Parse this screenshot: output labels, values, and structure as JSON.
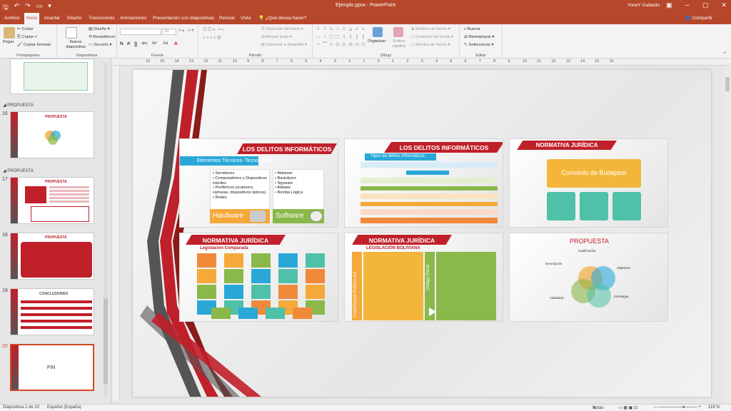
{
  "titlebar": {
    "title": "Ejemplo.ppsx  -  PowerPoint",
    "user": "YoneY Gallardo",
    "bg_color": "#b7472a"
  },
  "tabs": [
    "Archivo",
    "Inicio",
    "Insertar",
    "Diseño",
    "Transiciones",
    "Animaciones",
    "Presentación con diapositivas",
    "Revisar",
    "Vista"
  ],
  "active_tab": "Inicio",
  "tell_me": "¿Qué desea hacer?",
  "share": "Compartir",
  "ribbon": {
    "paste": "Pegar",
    "cut": "Cortar",
    "copy": "Copiar",
    "format_painter": "Copiar formato",
    "g_clipboard": "Portapapeles",
    "new_slide": "Nueva diapositiva",
    "layout": "Diseño",
    "reset": "Restablecer",
    "section": "Sección",
    "g_slides": "Diapositivas",
    "font_size": "32",
    "format_letters": [
      "N",
      "K",
      "S",
      "abc",
      "AV",
      "Aa"
    ],
    "g_font": "Fuente",
    "text_direction": "Dirección del texto",
    "align_text": "Alinear texto",
    "smartart": "Convertir a SmartArt",
    "g_paragraph": "Párrafo",
    "organize": "Organizar",
    "quick_styles": "Estilos rápidos",
    "shape_fill": "Relleno de forma",
    "shape_outline": "Contorno de forma",
    "shape_effects": "Efectos de forma",
    "g_drawing": "Dibujo",
    "find": "Buscar",
    "replace": "Reemplazar",
    "select": "Seleccionar",
    "g_editing": "Editar",
    "shape_glyphs": [
      "\\",
      "\\",
      "□",
      "○",
      "□",
      "△",
      "⌐",
      "⌐",
      "→",
      "↓",
      "⬚",
      "⬚",
      "⟨",
      "⟩",
      "{",
      "}",
      "~",
      "⌒",
      "☆",
      "⬠",
      "◇",
      "⬭",
      "▭",
      "⬡"
    ]
  },
  "thumbnails": [
    {
      "num": "",
      "section": ""
    },
    {
      "num": "16",
      "section": "PROPUESTA",
      "caption": "PROPUESTA"
    },
    {
      "num": "17",
      "section": "PROPUESTA",
      "caption": "PROPUESTA"
    },
    {
      "num": "18",
      "section": "",
      "caption": "PROPUESTA"
    },
    {
      "num": "19",
      "section": "",
      "caption": "CONCLUSIONES"
    },
    {
      "num": "20",
      "section": "",
      "caption": "FIN"
    }
  ],
  "ruler_numbers": [
    "16",
    "15",
    "14",
    "13",
    "12",
    "11",
    "10",
    "9",
    "8",
    "7",
    "6",
    "5",
    "4",
    "3",
    "2",
    "1",
    "0",
    "1",
    "2",
    "3",
    "4",
    "5",
    "6",
    "7",
    "8",
    "9",
    "10",
    "11",
    "12",
    "13",
    "14",
    "15",
    "16"
  ],
  "slide_cards": [
    {
      "title": "LOS DELITOS INFORMÁTICOS",
      "subtitle": "Elementos Técnicos- Tecnológicos",
      "left_items": [
        "• Servidores",
        "• Computadores y Dispositivos móviles",
        "• Periféricos (scanners, cámaras, dispositivos ópticos)",
        "• Redes"
      ],
      "right_items": [
        "• Malware",
        "• Backdoors",
        "• Spyware",
        "• Adware",
        "• Bomba Lógica"
      ],
      "left_label": "Hardware",
      "right_label": "Software"
    },
    {
      "title": "LOS DELITOS INFORMÁTICOS",
      "subtitle": "Tipos de delitos informáticos"
    },
    {
      "title": "NORMATIVA JURÍDICA",
      "center": "Convenio de Budapest"
    },
    {
      "title": "NORMATIVA JURÍDICA",
      "subtitle": "Legislación Comparada"
    },
    {
      "title": "NORMATIVA JURÍDICA",
      "subtitle": "LEGISLACIÓN BOLIVIANA",
      "left_vertical": "Constitución Política del",
      "right_vertical": "Código Penal"
    },
    {
      "title": "PROPUESTA",
      "labels": [
        "Justificación",
        "Descripción",
        "Objetivos",
        "Viabilidad",
        "Estrategia"
      ]
    }
  ],
  "colors": {
    "accent_red": "#c0202a",
    "dark_red": "#8b1a1a",
    "blue": "#29a8d8",
    "orange": "#f4a93a",
    "green": "#8bb84a",
    "teal": "#4fc1a8",
    "ppt_orange": "#d24726"
  },
  "status": {
    "slide_info": "Diapositiva 2 de 20",
    "language": "Español (España)",
    "notes": "Notas",
    "zoom": "119 %"
  }
}
